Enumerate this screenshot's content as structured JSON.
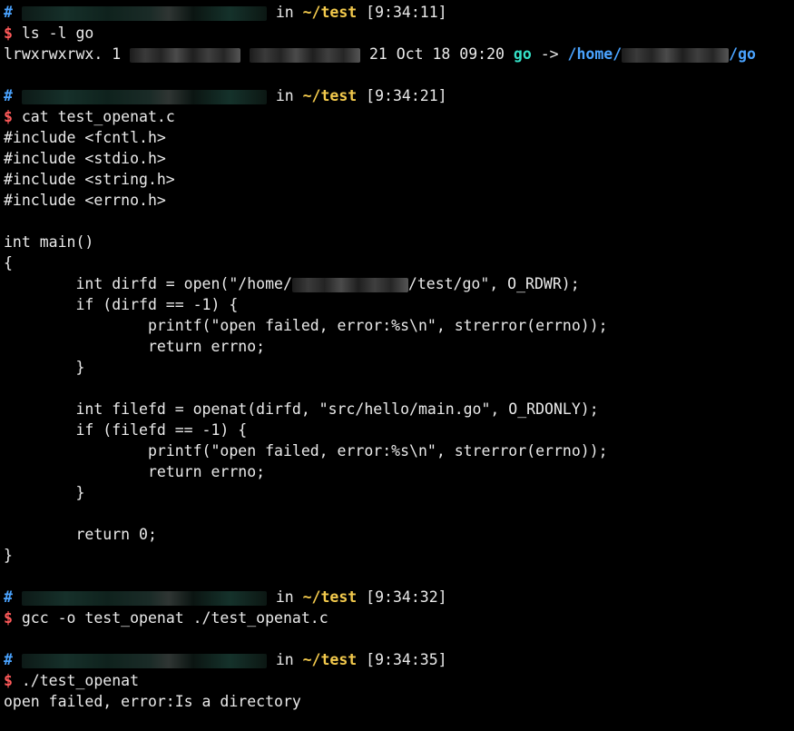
{
  "terminal": {
    "blocks": [
      {
        "prompt": {
          "hash": "#",
          "in": "in",
          "dir": "~/test",
          "time": "[9:34:11]"
        },
        "command": {
          "sign": "$",
          "text": "ls -l go"
        },
        "output": {
          "perms": "lrwxrwxrwx. 1",
          "date": "21 Oct 18 09:20",
          "link_name": "go",
          "arrow": "->",
          "target_prefix": "/home/",
          "target_suffix": "/go"
        }
      },
      {
        "prompt": {
          "hash": "#",
          "in": "in",
          "dir": "~/test",
          "time": "[9:34:21]"
        },
        "command": {
          "sign": "$",
          "text": "cat test_openat.c"
        },
        "code_lines": [
          "#include <fcntl.h>",
          "#include <stdio.h>",
          "#include <string.h>",
          "#include <errno.h>",
          "",
          "int main()",
          "{",
          "        int dirfd = open(\"/home/",
          "        if (dirfd == -1) {",
          "                printf(\"open failed, error:%s\\n\", strerror(errno));",
          "                return errno;",
          "        }",
          "",
          "        int filefd = openat(dirfd, \"src/hello/main.go\", O_RDONLY);",
          "        if (filefd == -1) {",
          "                printf(\"open failed, error:%s\\n\", strerror(errno));",
          "                return errno;",
          "        }",
          "",
          "        return 0;",
          "}"
        ],
        "open_line_suffix": "/test/go\", O_RDWR);"
      },
      {
        "prompt": {
          "hash": "#",
          "in": "in",
          "dir": "~/test",
          "time": "[9:34:32]"
        },
        "command": {
          "sign": "$",
          "text": "gcc -o test_openat ./test_openat.c"
        }
      },
      {
        "prompt": {
          "hash": "#",
          "in": "in",
          "dir": "~/test",
          "time": "[9:34:35]"
        },
        "command": {
          "sign": "$",
          "text": "./test_openat"
        },
        "output_text": "open failed, error:Is a directory"
      }
    ]
  },
  "colors": {
    "background": "#000000",
    "text": "#eaeaea",
    "prompt_hash": "#4aa3ff",
    "command_sign": "#ff5a5a",
    "directory": "#f2c94c",
    "symlink": "#34e2c8",
    "symlink_target": "#4aa3ff"
  }
}
